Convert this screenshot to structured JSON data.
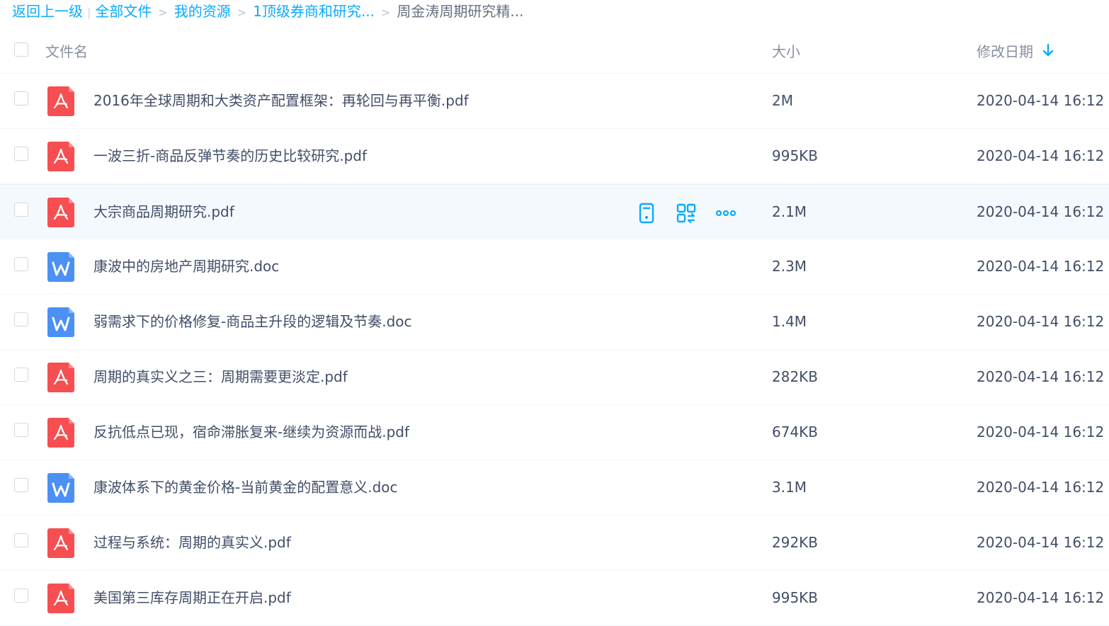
{
  "breadcrumb": {
    "back": "返回上一级",
    "separator_bar": "|",
    "arrow": ">",
    "items": [
      "全部文件",
      "我的资源",
      "1顶级券商和研究...",
      "周金涛周期研究精..."
    ]
  },
  "columns": {
    "name": "文件名",
    "size": "大小",
    "date": "修改日期",
    "sort_icon": "arrow-down-icon"
  },
  "colors": {
    "accent": "#09aaff",
    "pdf": "#f64e51",
    "doc": "#4b90f4",
    "row_hover": "#f4f9fe"
  },
  "hover_actions": [
    "phone-icon",
    "share-icon",
    "more-icon"
  ],
  "files": [
    {
      "name": "2016年全球周期和大类资产配置框架：再轮回与再平衡.pdf",
      "type": "pdf",
      "size": "2M",
      "date": "2020-04-14 16:12"
    },
    {
      "name": "一波三折-商品反弹节奏的历史比较研究.pdf",
      "type": "pdf",
      "size": "995KB",
      "date": "2020-04-14 16:12"
    },
    {
      "name": "大宗商品周期研究.pdf",
      "type": "pdf",
      "size": "2.1M",
      "date": "2020-04-14 16:12",
      "hover": true
    },
    {
      "name": "康波中的房地产周期研究.doc",
      "type": "doc",
      "size": "2.3M",
      "date": "2020-04-14 16:12"
    },
    {
      "name": "弱需求下的价格修复-商品主升段的逻辑及节奏.doc",
      "type": "doc",
      "size": "1.4M",
      "date": "2020-04-14 16:12"
    },
    {
      "name": "周期的真实义之三：周期需要更淡定.pdf",
      "type": "pdf",
      "size": "282KB",
      "date": "2020-04-14 16:12"
    },
    {
      "name": "反抗低点已现，宿命滞胀复来-继续为资源而战.pdf",
      "type": "pdf",
      "size": "674KB",
      "date": "2020-04-14 16:12"
    },
    {
      "name": "康波体系下的黄金价格-当前黄金的配置意义.doc",
      "type": "doc",
      "size": "3.1M",
      "date": "2020-04-14 16:12"
    },
    {
      "name": "过程与系统：周期的真实义.pdf",
      "type": "pdf",
      "size": "292KB",
      "date": "2020-04-14 16:12"
    },
    {
      "name": "美国第三库存周期正在开启.pdf",
      "type": "pdf",
      "size": "995KB",
      "date": "2020-04-14 16:12"
    }
  ]
}
